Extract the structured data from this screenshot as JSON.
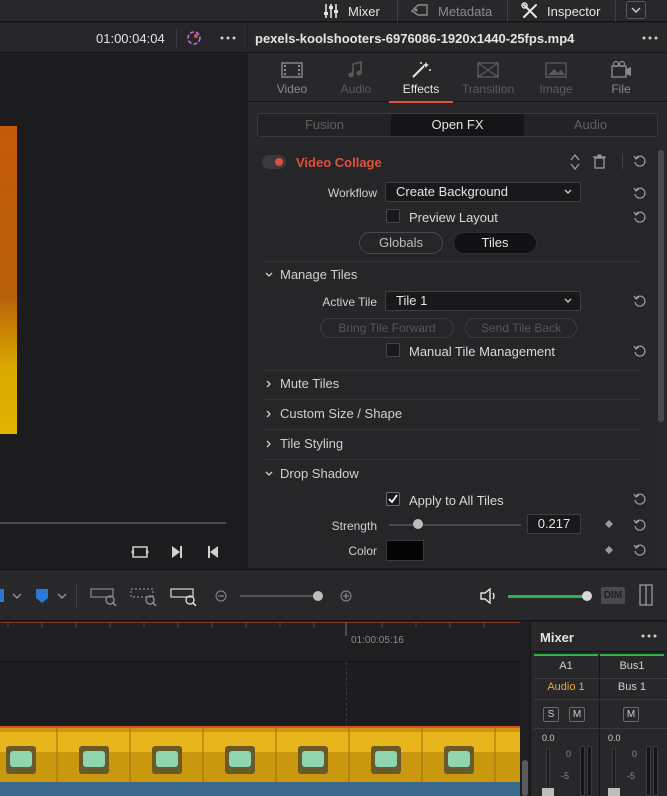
{
  "topbar": {
    "mixer_label": "Mixer",
    "metadata_label": "Metadata",
    "inspector_label": "Inspector"
  },
  "viewer": {
    "timecode": "01:00:04:04"
  },
  "inspector": {
    "clip_name": "pexels-koolshooters-6976086-1920x1440-25fps.mp4",
    "tabs": [
      {
        "label": "Video",
        "icon": "film-icon",
        "state": "normal"
      },
      {
        "label": "Audio",
        "icon": "music-note-icon",
        "state": "disabled"
      },
      {
        "label": "Effects",
        "icon": "magic-wand-icon",
        "state": "active"
      },
      {
        "label": "Transition",
        "icon": "transition-icon",
        "state": "disabled"
      },
      {
        "label": "Image",
        "icon": "image-icon",
        "state": "disabled"
      },
      {
        "label": "File",
        "icon": "film-reel-icon",
        "state": "normal"
      }
    ],
    "segments": [
      "Fusion",
      "Open FX",
      "Audio"
    ],
    "effect": {
      "name": "Video Collage",
      "workflow_label": "Workflow",
      "workflow_value": "Create Background",
      "preview_layout_label": "Preview Layout",
      "globals_label": "Globals",
      "tiles_label": "Tiles",
      "manage_tiles_label": "Manage Tiles",
      "active_tile_label": "Active Tile",
      "active_tile_value": "Tile 1",
      "bring_forward_label": "Bring Tile Forward",
      "send_back_label": "Send Tile Back",
      "manual_tile_label": "Manual Tile Management",
      "mute_tiles_label": "Mute Tiles",
      "custom_size_label": "Custom Size / Shape",
      "tile_styling_label": "Tile Styling",
      "drop_shadow_label": "Drop Shadow",
      "apply_all_label": "Apply to All Tiles",
      "strength_label": "Strength",
      "strength_value": "0.217",
      "strength_fraction": 0.217,
      "color_label": "Color"
    }
  },
  "timeline": {
    "ruler_timecode": "01:00:05:16"
  },
  "mixer": {
    "title": "Mixer",
    "channels": [
      {
        "name": "A1",
        "track": "Audio 1",
        "level": "0.0"
      },
      {
        "name": "Bus1",
        "track": "Bus 1",
        "level": "0.0"
      }
    ],
    "solo_label": "S",
    "mute_label": "M",
    "scale_0": "0",
    "scale_5": "-5",
    "dim_label": "DIM"
  },
  "colors": {
    "accent": "#e0513b",
    "audio_accent": "#e8a83a",
    "meter_green": "#2fb34a"
  }
}
